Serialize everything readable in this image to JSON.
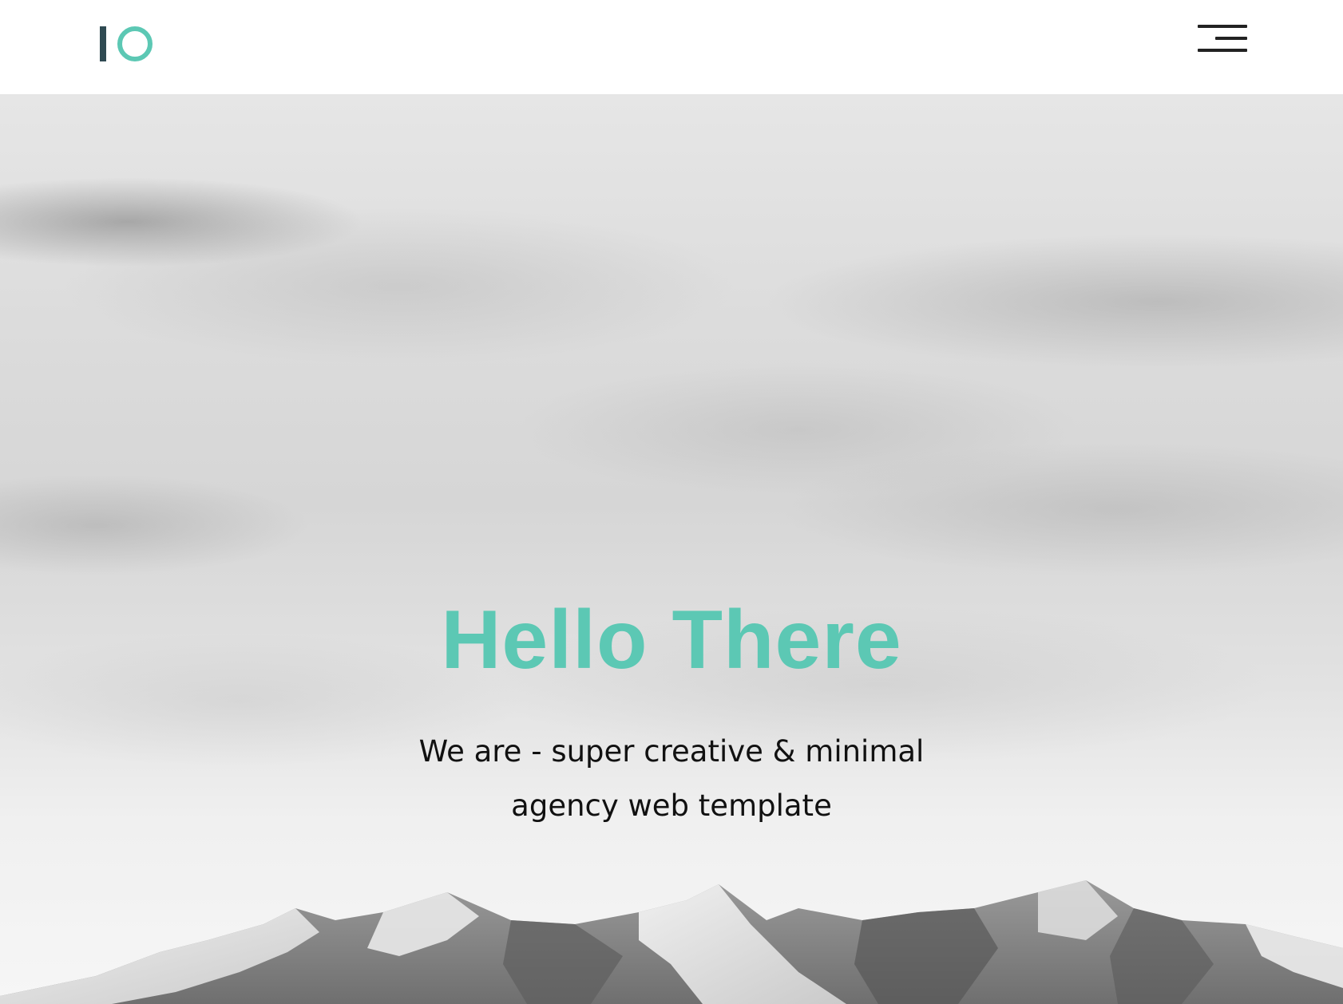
{
  "header": {
    "logo_icon": "io-logo",
    "menu_icon": "hamburger-menu-icon"
  },
  "hero": {
    "title": "Hello There",
    "subtitle": "We are - super creative & minimal agency web template",
    "background": "cloudy-sky-snowy-mountains"
  },
  "colors": {
    "accent": "#5cc8b4",
    "logo_dark": "#2f4a52",
    "text": "#111111"
  }
}
